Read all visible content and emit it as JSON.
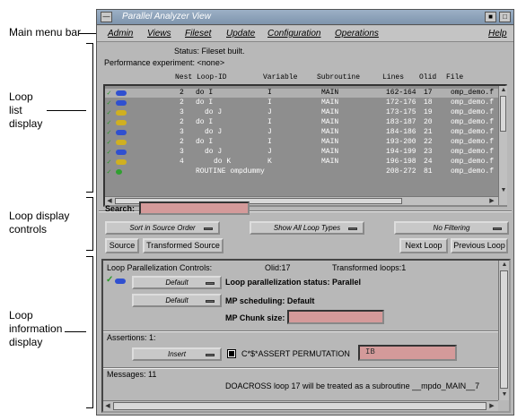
{
  "callouts": {
    "menu_bar": "Main menu bar",
    "loop_list": [
      "Loop",
      "list",
      "display"
    ],
    "loop_controls": [
      "Loop display",
      "controls"
    ],
    "loop_info": [
      "Loop",
      "information",
      "display"
    ]
  },
  "window": {
    "title": "Parallel Analyzer View",
    "menu": [
      "Admin",
      "Views",
      "Fileset",
      "Update",
      "Configuration",
      "Operations",
      "Help"
    ]
  },
  "status": {
    "line1": "Status: Fileset built.",
    "line2": "Performance experiment: <none>"
  },
  "list_headers": [
    "Nest",
    "Loop-ID",
    "Variable",
    "Subroutine",
    "Lines",
    "Olid",
    "File"
  ],
  "loops": [
    {
      "nest": "2",
      "id": "do I",
      "var": "I",
      "sub": "MAIN",
      "lines": "162-164",
      "olid": "17",
      "file": "omp_demo.f",
      "icon": "b",
      "check": true
    },
    {
      "nest": "2",
      "id": "do I",
      "var": "I",
      "sub": "MAIN",
      "lines": "172-176",
      "olid": "18",
      "file": "omp_demo.f",
      "icon": "b",
      "check": true
    },
    {
      "nest": "3",
      "id": "do J",
      "var": "J",
      "sub": "MAIN",
      "lines": "173-175",
      "olid": "19",
      "file": "omp_demo.f",
      "icon": "y",
      "check": true
    },
    {
      "nest": "2",
      "id": "do I",
      "var": "I",
      "sub": "MAIN",
      "lines": "183-187",
      "olid": "20",
      "file": "omp_demo.f",
      "icon": "y",
      "check": true
    },
    {
      "nest": "3",
      "id": "do J",
      "var": "J",
      "sub": "MAIN",
      "lines": "184-186",
      "olid": "21",
      "file": "omp_demo.f",
      "icon": "b",
      "check": true
    },
    {
      "nest": "2",
      "id": "do I",
      "var": "I",
      "sub": "MAIN",
      "lines": "193-200",
      "olid": "22",
      "file": "omp_demo.f",
      "icon": "y",
      "check": true
    },
    {
      "nest": "3",
      "id": "do J",
      "var": "J",
      "sub": "MAIN",
      "lines": "194-199",
      "olid": "23",
      "file": "omp_demo.f",
      "icon": "b",
      "check": true
    },
    {
      "nest": "4",
      "id": "do K",
      "var": "K",
      "sub": "MAIN",
      "lines": "196-198",
      "olid": "24",
      "file": "omp_demo.f",
      "icon": "y",
      "check": true
    },
    {
      "nest": "",
      "id": "ROUTINE ompdummy",
      "var": "",
      "sub": "",
      "lines": "208-272",
      "olid": "81",
      "file": "omp_demo.f",
      "icon": "r",
      "check": true
    }
  ],
  "controls": {
    "search_label": "Search:",
    "sort": "Sort in Source Order",
    "types": "Show All Loop Types",
    "filter": "No Filtering",
    "source": "Source",
    "transformed": "Transformed Source",
    "next": "Next Loop",
    "previous": "Previous Loop"
  },
  "info": {
    "controls_label": "Loop Parallelization Controls:",
    "olid": "Olid:17",
    "transformed": "Transformed loops:1",
    "default1": "Default",
    "par_status": "Loop parallelization status: Parallel",
    "default2": "Default",
    "mp_sched": "MP scheduling: Default",
    "chunk_label": "MP Chunk size:",
    "assertions": "Assertions: 1:",
    "insert": "Insert",
    "assert_text": "C*$*ASSERT PERMUTATION",
    "assert_value": "IB",
    "messages": "Messages: 11",
    "message_text": "DOACROSS loop 17 will be treated as a subroutine __mpdo_MAIN__7"
  }
}
